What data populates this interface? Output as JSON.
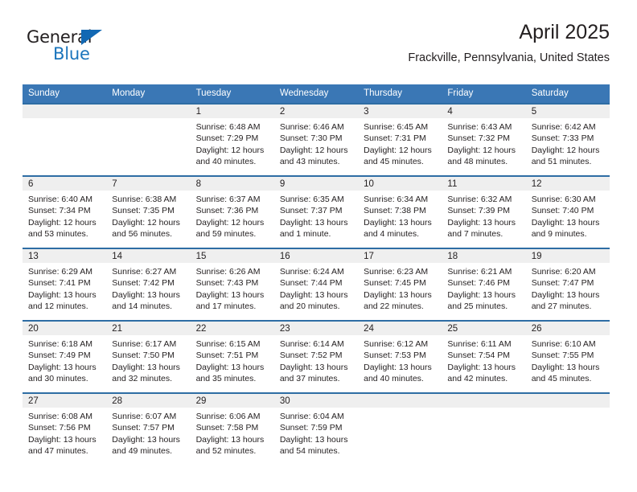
{
  "brand": {
    "name_part1": "General",
    "name_part2": "Blue",
    "accent_color": "#1b75bc",
    "triangle_color": "#1268b3"
  },
  "header": {
    "title": "April 2025",
    "subtitle": "Frackville, Pennsylvania, United States"
  },
  "theme": {
    "header_row_bg": "#3a77b5",
    "row_divider": "#2e6da4",
    "daynum_band_bg": "#efefef",
    "text": "#231f20"
  },
  "calendar": {
    "weekday_headers": [
      "Sunday",
      "Monday",
      "Tuesday",
      "Wednesday",
      "Thursday",
      "Friday",
      "Saturday"
    ],
    "labels": {
      "sunrise_prefix": "Sunrise:",
      "sunset_prefix": "Sunset:",
      "daylight_prefix": "Daylight:"
    },
    "weeks": [
      [
        {
          "day": "",
          "sunrise": "",
          "sunset": "",
          "daylight": ""
        },
        {
          "day": "",
          "sunrise": "",
          "sunset": "",
          "daylight": ""
        },
        {
          "day": "1",
          "sunrise": "Sunrise: 6:48 AM",
          "sunset": "Sunset: 7:29 PM",
          "daylight": "Daylight: 12 hours and 40 minutes."
        },
        {
          "day": "2",
          "sunrise": "Sunrise: 6:46 AM",
          "sunset": "Sunset: 7:30 PM",
          "daylight": "Daylight: 12 hours and 43 minutes."
        },
        {
          "day": "3",
          "sunrise": "Sunrise: 6:45 AM",
          "sunset": "Sunset: 7:31 PM",
          "daylight": "Daylight: 12 hours and 45 minutes."
        },
        {
          "day": "4",
          "sunrise": "Sunrise: 6:43 AM",
          "sunset": "Sunset: 7:32 PM",
          "daylight": "Daylight: 12 hours and 48 minutes."
        },
        {
          "day": "5",
          "sunrise": "Sunrise: 6:42 AM",
          "sunset": "Sunset: 7:33 PM",
          "daylight": "Daylight: 12 hours and 51 minutes."
        }
      ],
      [
        {
          "day": "6",
          "sunrise": "Sunrise: 6:40 AM",
          "sunset": "Sunset: 7:34 PM",
          "daylight": "Daylight: 12 hours and 53 minutes."
        },
        {
          "day": "7",
          "sunrise": "Sunrise: 6:38 AM",
          "sunset": "Sunset: 7:35 PM",
          "daylight": "Daylight: 12 hours and 56 minutes."
        },
        {
          "day": "8",
          "sunrise": "Sunrise: 6:37 AM",
          "sunset": "Sunset: 7:36 PM",
          "daylight": "Daylight: 12 hours and 59 minutes."
        },
        {
          "day": "9",
          "sunrise": "Sunrise: 6:35 AM",
          "sunset": "Sunset: 7:37 PM",
          "daylight": "Daylight: 13 hours and 1 minute."
        },
        {
          "day": "10",
          "sunrise": "Sunrise: 6:34 AM",
          "sunset": "Sunset: 7:38 PM",
          "daylight": "Daylight: 13 hours and 4 minutes."
        },
        {
          "day": "11",
          "sunrise": "Sunrise: 6:32 AM",
          "sunset": "Sunset: 7:39 PM",
          "daylight": "Daylight: 13 hours and 7 minutes."
        },
        {
          "day": "12",
          "sunrise": "Sunrise: 6:30 AM",
          "sunset": "Sunset: 7:40 PM",
          "daylight": "Daylight: 13 hours and 9 minutes."
        }
      ],
      [
        {
          "day": "13",
          "sunrise": "Sunrise: 6:29 AM",
          "sunset": "Sunset: 7:41 PM",
          "daylight": "Daylight: 13 hours and 12 minutes."
        },
        {
          "day": "14",
          "sunrise": "Sunrise: 6:27 AM",
          "sunset": "Sunset: 7:42 PM",
          "daylight": "Daylight: 13 hours and 14 minutes."
        },
        {
          "day": "15",
          "sunrise": "Sunrise: 6:26 AM",
          "sunset": "Sunset: 7:43 PM",
          "daylight": "Daylight: 13 hours and 17 minutes."
        },
        {
          "day": "16",
          "sunrise": "Sunrise: 6:24 AM",
          "sunset": "Sunset: 7:44 PM",
          "daylight": "Daylight: 13 hours and 20 minutes."
        },
        {
          "day": "17",
          "sunrise": "Sunrise: 6:23 AM",
          "sunset": "Sunset: 7:45 PM",
          "daylight": "Daylight: 13 hours and 22 minutes."
        },
        {
          "day": "18",
          "sunrise": "Sunrise: 6:21 AM",
          "sunset": "Sunset: 7:46 PM",
          "daylight": "Daylight: 13 hours and 25 minutes."
        },
        {
          "day": "19",
          "sunrise": "Sunrise: 6:20 AM",
          "sunset": "Sunset: 7:47 PM",
          "daylight": "Daylight: 13 hours and 27 minutes."
        }
      ],
      [
        {
          "day": "20",
          "sunrise": "Sunrise: 6:18 AM",
          "sunset": "Sunset: 7:49 PM",
          "daylight": "Daylight: 13 hours and 30 minutes."
        },
        {
          "day": "21",
          "sunrise": "Sunrise: 6:17 AM",
          "sunset": "Sunset: 7:50 PM",
          "daylight": "Daylight: 13 hours and 32 minutes."
        },
        {
          "day": "22",
          "sunrise": "Sunrise: 6:15 AM",
          "sunset": "Sunset: 7:51 PM",
          "daylight": "Daylight: 13 hours and 35 minutes."
        },
        {
          "day": "23",
          "sunrise": "Sunrise: 6:14 AM",
          "sunset": "Sunset: 7:52 PM",
          "daylight": "Daylight: 13 hours and 37 minutes."
        },
        {
          "day": "24",
          "sunrise": "Sunrise: 6:12 AM",
          "sunset": "Sunset: 7:53 PM",
          "daylight": "Daylight: 13 hours and 40 minutes."
        },
        {
          "day": "25",
          "sunrise": "Sunrise: 6:11 AM",
          "sunset": "Sunset: 7:54 PM",
          "daylight": "Daylight: 13 hours and 42 minutes."
        },
        {
          "day": "26",
          "sunrise": "Sunrise: 6:10 AM",
          "sunset": "Sunset: 7:55 PM",
          "daylight": "Daylight: 13 hours and 45 minutes."
        }
      ],
      [
        {
          "day": "27",
          "sunrise": "Sunrise: 6:08 AM",
          "sunset": "Sunset: 7:56 PM",
          "daylight": "Daylight: 13 hours and 47 minutes."
        },
        {
          "day": "28",
          "sunrise": "Sunrise: 6:07 AM",
          "sunset": "Sunset: 7:57 PM",
          "daylight": "Daylight: 13 hours and 49 minutes."
        },
        {
          "day": "29",
          "sunrise": "Sunrise: 6:06 AM",
          "sunset": "Sunset: 7:58 PM",
          "daylight": "Daylight: 13 hours and 52 minutes."
        },
        {
          "day": "30",
          "sunrise": "Sunrise: 6:04 AM",
          "sunset": "Sunset: 7:59 PM",
          "daylight": "Daylight: 13 hours and 54 minutes."
        },
        {
          "day": "",
          "sunrise": "",
          "sunset": "",
          "daylight": ""
        },
        {
          "day": "",
          "sunrise": "",
          "sunset": "",
          "daylight": ""
        },
        {
          "day": "",
          "sunrise": "",
          "sunset": "",
          "daylight": ""
        }
      ]
    ]
  }
}
